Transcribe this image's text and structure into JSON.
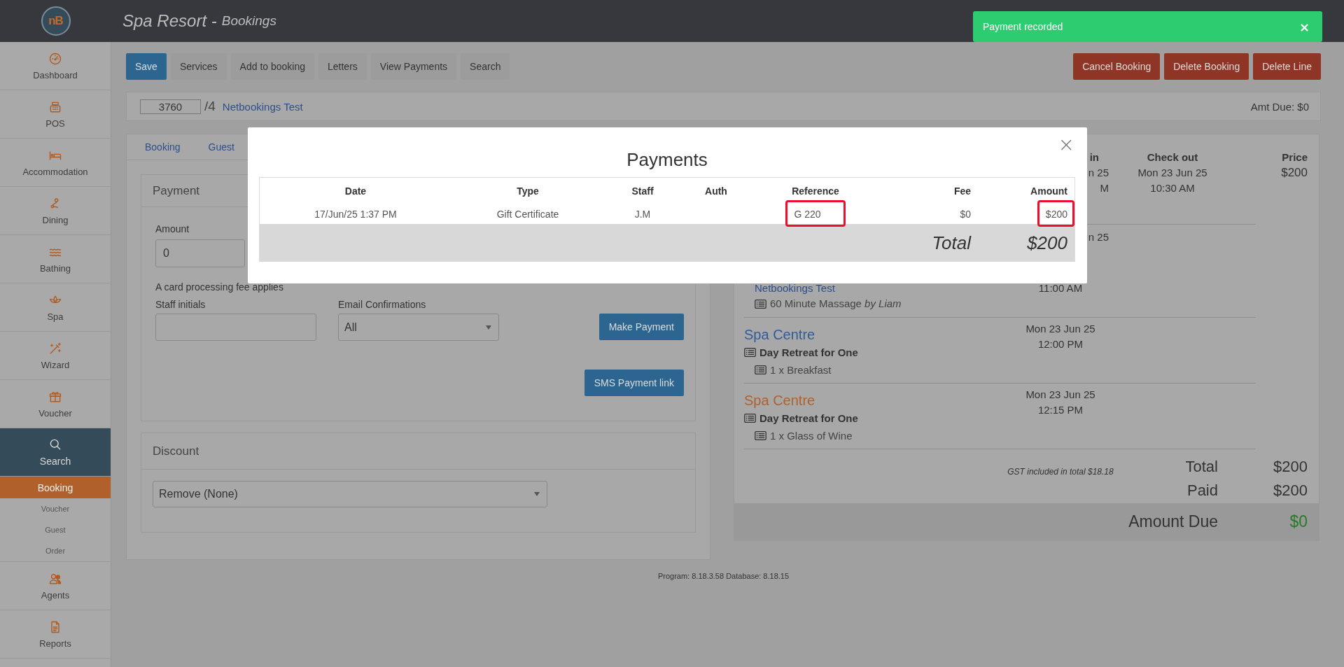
{
  "header": {
    "logo": "nB",
    "title": "Spa Resort -",
    "subtitle": "Bookings"
  },
  "toast": {
    "message": "Payment recorded",
    "close": "×"
  },
  "sidebar": {
    "items": [
      {
        "label": "Dashboard",
        "selected": false
      },
      {
        "label": "POS",
        "selected": false
      },
      {
        "label": "Accommodation",
        "selected": false
      },
      {
        "label": "Dining",
        "selected": false
      },
      {
        "label": "Bathing",
        "selected": false
      },
      {
        "label": "Spa",
        "selected": false
      },
      {
        "label": "Wizard",
        "selected": false
      },
      {
        "label": "Voucher",
        "selected": false
      },
      {
        "label": "Search",
        "selected": true,
        "children": [
          {
            "label": "Booking",
            "selected": true
          },
          {
            "label": "Voucher",
            "selected": false
          },
          {
            "label": "Guest",
            "selected": false
          },
          {
            "label": "Order",
            "selected": false
          }
        ]
      },
      {
        "label": "Agents",
        "selected": false
      },
      {
        "label": "Reports",
        "selected": false
      }
    ]
  },
  "toolbar": {
    "left": [
      {
        "label": "Save",
        "kind": "primary"
      },
      {
        "label": "Services",
        "kind": "default"
      },
      {
        "label": "Add to booking",
        "kind": "default"
      },
      {
        "label": "Letters",
        "kind": "default"
      },
      {
        "label": "View Payments",
        "kind": "default"
      },
      {
        "label": "Search",
        "kind": "default"
      }
    ],
    "right": [
      {
        "label": "Cancel Booking",
        "kind": "danger"
      },
      {
        "label": "Delete Booking",
        "kind": "danger"
      },
      {
        "label": "Delete Line",
        "kind": "danger"
      }
    ]
  },
  "booking_bar": {
    "number": "3760",
    "suffix": "/4",
    "guest": "Netbookings Test",
    "amount_due": "Amt Due: $0"
  },
  "tabs": [
    "Booking",
    "Guest"
  ],
  "payment": {
    "title": "Payment",
    "amount_label": "Amount",
    "amount": "0",
    "fee_note": "A card processing fee applies",
    "staff_label": "Staff initials",
    "email_label": "Email Confirmations",
    "email_value": "All",
    "buttons": [
      "Make Payment",
      "SMS Payment link"
    ]
  },
  "discount": {
    "title": "Discount",
    "value": "Remove (None)"
  },
  "summary": {
    "columns": {
      "checkin": "in",
      "checkout": "Check out",
      "price": "Price"
    },
    "rows": [
      {
        "kind": "covered_top",
        "checkin": [
          "n 25",
          "M"
        ],
        "checkout": [
          "Mon 23 Jun 25",
          "10:30 AM"
        ],
        "price": "$200"
      },
      {
        "kind": "covered",
        "checkin": [
          "n 25"
        ],
        "guest": "Netbookings Test",
        "time": "11:00 AM",
        "item": "60 Minute Massage *by* *Liam*"
      },
      {
        "kind": "service",
        "venue": "Spa Centre",
        "color": "#2f5b9a",
        "checkin": [
          "Mon 23 Jun 25",
          "12:00 PM"
        ],
        "package": "Day Retreat for One",
        "item": "1 x Breakfast"
      },
      {
        "kind": "service",
        "venue": "Spa Centre",
        "color": "#b0612b",
        "checkin": [
          "Mon 23 Jun 25",
          "12:15 PM"
        ],
        "package": "Day Retreat for One",
        "item": "1 x Glass of Wine"
      }
    ],
    "gst_note": "GST included in total $18.18",
    "totals": [
      {
        "label": "Total",
        "value": "$200"
      },
      {
        "label": "Paid",
        "value": "$200"
      }
    ],
    "due": {
      "label": "Amount Due",
      "value": "$0"
    }
  },
  "footer": "Program: 8.18.3.58 Database: 8.18.15",
  "modal": {
    "title": "Payments",
    "close": "×",
    "columns": [
      "Date",
      "Type",
      "Staff",
      "Auth",
      "Reference",
      "Fee",
      "Amount"
    ],
    "rows": [
      {
        "cells": [
          {
            "text": "17/Jun/25 1:37 PM",
            "highlighted": false
          },
          {
            "text": "Gift Certificate",
            "highlighted": false
          },
          {
            "text": "J.M",
            "highlighted": false
          },
          null,
          {
            "text": "G 220",
            "highlighted": true
          },
          {
            "text": "$0",
            "highlighted": false
          },
          {
            "text": "$200",
            "highlighted": true
          }
        ]
      }
    ],
    "total": {
      "label": "Total",
      "value": "$200"
    }
  }
}
